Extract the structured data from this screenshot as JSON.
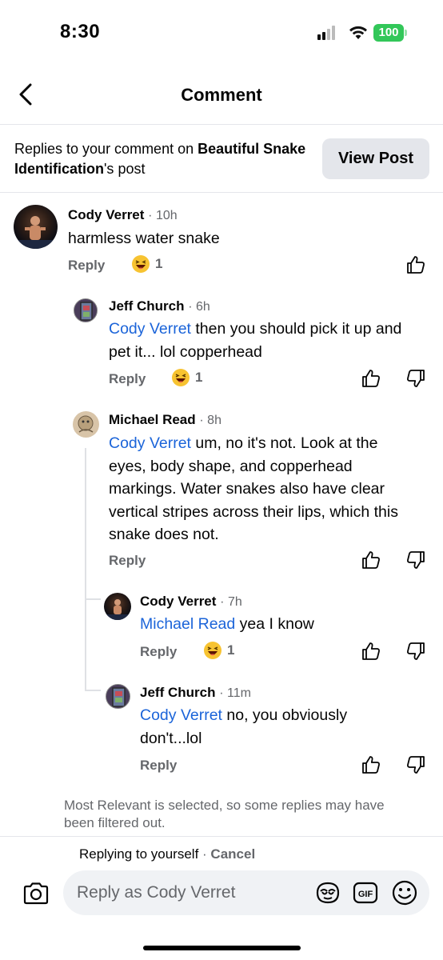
{
  "status_bar": {
    "time": "8:30",
    "battery": "100"
  },
  "header": {
    "title": "Comment"
  },
  "context": {
    "prefix": "Replies to your comment on ",
    "page_name": "Beautiful Snake Identification",
    "suffix": "'s post",
    "view_post_label": "View Post"
  },
  "comments": [
    {
      "author": "Cody Verret",
      "age": "· 10h",
      "mention": "",
      "text": "harmless water snake",
      "reply_label": "Reply",
      "reaction_count": "1"
    },
    {
      "author": "Jeff Church",
      "age": "· 6h",
      "mention": "Cody Verret",
      "text": " then you should pick it up and pet it... lol copperhead",
      "reply_label": "Reply",
      "reaction_count": "1"
    },
    {
      "author": "Michael Read",
      "age": "· 8h",
      "mention": "Cody Verret",
      "text": " um, no it's not. Look at the eyes, body shape, and copperhead markings. Water snakes also have clear vertical stripes across their lips, which this snake does not.",
      "reply_label": "Reply",
      "reaction_count": ""
    },
    {
      "author": "Cody Verret",
      "age": "· 7h",
      "mention": "Michael Read",
      "text": " yea I know",
      "reply_label": "Reply",
      "reaction_count": "1"
    },
    {
      "author": "Jeff Church",
      "age": "· 11m",
      "mention": "Cody Verret",
      "text": " no, you obviously don't...lol",
      "reply_label": "Reply",
      "reaction_count": ""
    }
  ],
  "filter_note": "Most Relevant is selected, so some replies may have been filtered out.",
  "composer": {
    "replying_to": "Replying to yourself",
    "separator": " · ",
    "cancel_label": "Cancel",
    "placeholder": "Reply as Cody Verret"
  },
  "colors": {
    "mention": "#1b64d9",
    "muted": "#65676b",
    "battery": "#32c759",
    "divider": "#e4e6eb"
  },
  "icons": [
    "back-chevron-icon",
    "camera-icon",
    "avatar-sticker-icon",
    "gif-icon",
    "smiley-icon",
    "like-icon",
    "dislike-icon",
    "laughing-emoji-icon"
  ]
}
